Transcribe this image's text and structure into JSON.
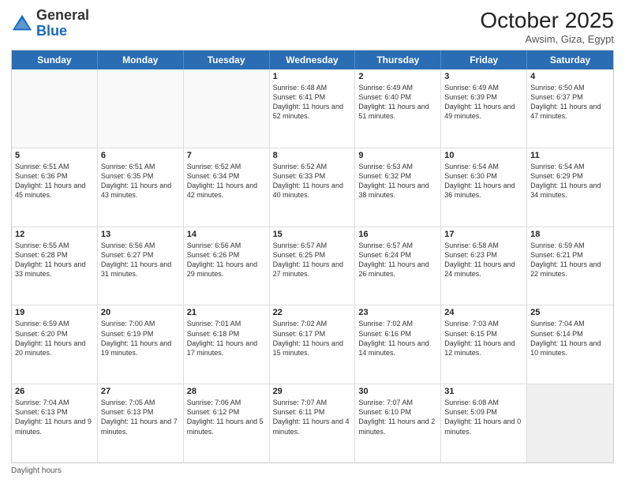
{
  "header": {
    "logo_general": "General",
    "logo_blue": "Blue",
    "month_title": "October 2025",
    "location": "Awsim, Giza, Egypt"
  },
  "days_of_week": [
    "Sunday",
    "Monday",
    "Tuesday",
    "Wednesday",
    "Thursday",
    "Friday",
    "Saturday"
  ],
  "footer": {
    "daylight_label": "Daylight hours"
  },
  "weeks": [
    [
      {
        "day": "",
        "text": "",
        "empty": true
      },
      {
        "day": "",
        "text": "",
        "empty": true
      },
      {
        "day": "",
        "text": "",
        "empty": true
      },
      {
        "day": "1",
        "text": "Sunrise: 6:48 AM\nSunset: 6:41 PM\nDaylight: 11 hours and 52 minutes.",
        "empty": false
      },
      {
        "day": "2",
        "text": "Sunrise: 6:49 AM\nSunset: 6:40 PM\nDaylight: 11 hours and 51 minutes.",
        "empty": false
      },
      {
        "day": "3",
        "text": "Sunrise: 6:49 AM\nSunset: 6:39 PM\nDaylight: 11 hours and 49 minutes.",
        "empty": false
      },
      {
        "day": "4",
        "text": "Sunrise: 6:50 AM\nSunset: 6:37 PM\nDaylight: 11 hours and 47 minutes.",
        "empty": false
      }
    ],
    [
      {
        "day": "5",
        "text": "Sunrise: 6:51 AM\nSunset: 6:36 PM\nDaylight: 11 hours and 45 minutes.",
        "empty": false
      },
      {
        "day": "6",
        "text": "Sunrise: 6:51 AM\nSunset: 6:35 PM\nDaylight: 11 hours and 43 minutes.",
        "empty": false
      },
      {
        "day": "7",
        "text": "Sunrise: 6:52 AM\nSunset: 6:34 PM\nDaylight: 11 hours and 42 minutes.",
        "empty": false
      },
      {
        "day": "8",
        "text": "Sunrise: 6:52 AM\nSunset: 6:33 PM\nDaylight: 11 hours and 40 minutes.",
        "empty": false
      },
      {
        "day": "9",
        "text": "Sunrise: 6:53 AM\nSunset: 6:32 PM\nDaylight: 11 hours and 38 minutes.",
        "empty": false
      },
      {
        "day": "10",
        "text": "Sunrise: 6:54 AM\nSunset: 6:30 PM\nDaylight: 11 hours and 36 minutes.",
        "empty": false
      },
      {
        "day": "11",
        "text": "Sunrise: 6:54 AM\nSunset: 6:29 PM\nDaylight: 11 hours and 34 minutes.",
        "empty": false
      }
    ],
    [
      {
        "day": "12",
        "text": "Sunrise: 6:55 AM\nSunset: 6:28 PM\nDaylight: 11 hours and 33 minutes.",
        "empty": false
      },
      {
        "day": "13",
        "text": "Sunrise: 6:56 AM\nSunset: 6:27 PM\nDaylight: 11 hours and 31 minutes.",
        "empty": false
      },
      {
        "day": "14",
        "text": "Sunrise: 6:56 AM\nSunset: 6:26 PM\nDaylight: 11 hours and 29 minutes.",
        "empty": false
      },
      {
        "day": "15",
        "text": "Sunrise: 6:57 AM\nSunset: 6:25 PM\nDaylight: 11 hours and 27 minutes.",
        "empty": false
      },
      {
        "day": "16",
        "text": "Sunrise: 6:57 AM\nSunset: 6:24 PM\nDaylight: 11 hours and 26 minutes.",
        "empty": false
      },
      {
        "day": "17",
        "text": "Sunrise: 6:58 AM\nSunset: 6:23 PM\nDaylight: 11 hours and 24 minutes.",
        "empty": false
      },
      {
        "day": "18",
        "text": "Sunrise: 6:59 AM\nSunset: 6:21 PM\nDaylight: 11 hours and 22 minutes.",
        "empty": false
      }
    ],
    [
      {
        "day": "19",
        "text": "Sunrise: 6:59 AM\nSunset: 6:20 PM\nDaylight: 11 hours and 20 minutes.",
        "empty": false
      },
      {
        "day": "20",
        "text": "Sunrise: 7:00 AM\nSunset: 6:19 PM\nDaylight: 11 hours and 19 minutes.",
        "empty": false
      },
      {
        "day": "21",
        "text": "Sunrise: 7:01 AM\nSunset: 6:18 PM\nDaylight: 11 hours and 17 minutes.",
        "empty": false
      },
      {
        "day": "22",
        "text": "Sunrise: 7:02 AM\nSunset: 6:17 PM\nDaylight: 11 hours and 15 minutes.",
        "empty": false
      },
      {
        "day": "23",
        "text": "Sunrise: 7:02 AM\nSunset: 6:16 PM\nDaylight: 11 hours and 14 minutes.",
        "empty": false
      },
      {
        "day": "24",
        "text": "Sunrise: 7:03 AM\nSunset: 6:15 PM\nDaylight: 11 hours and 12 minutes.",
        "empty": false
      },
      {
        "day": "25",
        "text": "Sunrise: 7:04 AM\nSunset: 6:14 PM\nDaylight: 11 hours and 10 minutes.",
        "empty": false
      }
    ],
    [
      {
        "day": "26",
        "text": "Sunrise: 7:04 AM\nSunset: 6:13 PM\nDaylight: 11 hours and 9 minutes.",
        "empty": false
      },
      {
        "day": "27",
        "text": "Sunrise: 7:05 AM\nSunset: 6:13 PM\nDaylight: 11 hours and 7 minutes.",
        "empty": false
      },
      {
        "day": "28",
        "text": "Sunrise: 7:06 AM\nSunset: 6:12 PM\nDaylight: 11 hours and 5 minutes.",
        "empty": false
      },
      {
        "day": "29",
        "text": "Sunrise: 7:07 AM\nSunset: 6:11 PM\nDaylight: 11 hours and 4 minutes.",
        "empty": false
      },
      {
        "day": "30",
        "text": "Sunrise: 7:07 AM\nSunset: 6:10 PM\nDaylight: 11 hours and 2 minutes.",
        "empty": false
      },
      {
        "day": "31",
        "text": "Sunrise: 6:08 AM\nSunset: 5:09 PM\nDaylight: 11 hours and 0 minutes.",
        "empty": false
      },
      {
        "day": "",
        "text": "",
        "empty": true
      }
    ]
  ]
}
